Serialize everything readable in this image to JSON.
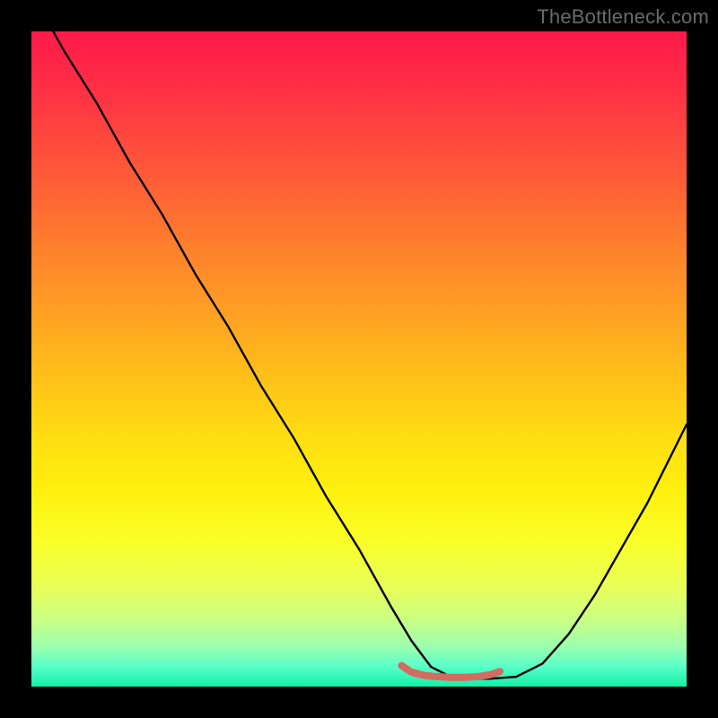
{
  "watermark": "TheBottleneck.com",
  "colors": {
    "frame": "#000000",
    "curve": "#000000",
    "segment": "#d46a60",
    "gradient_top": "#ff1a4a",
    "gradient_bottom": "#10f0a8"
  },
  "chart_data": {
    "type": "line",
    "title": "",
    "xlabel": "",
    "ylabel": "",
    "xlim": [
      0,
      100
    ],
    "ylim": [
      0,
      100
    ],
    "grid": false,
    "series": [
      {
        "name": "bottleneck-curve",
        "x": [
          0,
          5,
          10,
          15,
          20,
          25,
          30,
          35,
          40,
          45,
          50,
          55,
          58,
          61,
          64,
          67,
          70,
          74,
          78,
          82,
          86,
          90,
          94,
          100
        ],
        "values": [
          106,
          97,
          89,
          80,
          72,
          63,
          55,
          46,
          38,
          29,
          21,
          12,
          7,
          3,
          1.5,
          1.2,
          1.2,
          1.5,
          3.5,
          8,
          14,
          21,
          28,
          40
        ]
      }
    ],
    "annotations": [
      {
        "name": "flat-bottom-segment",
        "color": "#d46a60",
        "x": [
          56.5,
          58,
          60,
          62,
          64,
          66,
          68,
          70,
          71.5
        ],
        "values": [
          3.2,
          2.2,
          1.7,
          1.5,
          1.4,
          1.4,
          1.5,
          1.8,
          2.3
        ]
      }
    ]
  }
}
